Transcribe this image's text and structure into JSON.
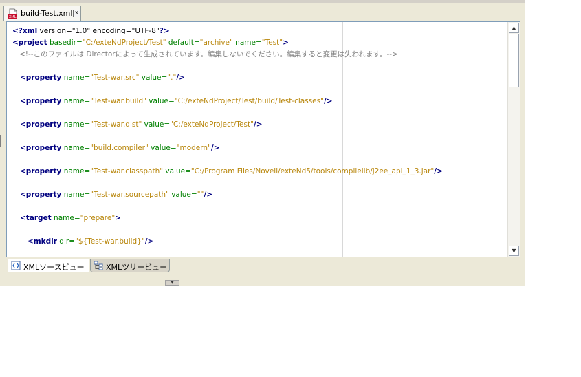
{
  "file_tab": {
    "label": "build-Test.xml",
    "icon": "xml-file-icon",
    "close_symbol": "x"
  },
  "code_lines": [
    [
      {
        "c": "tag",
        "t": "<?xml"
      },
      {
        "c": "txt",
        "t": " version=\"1.0\" encoding=\"UTF-8\""
      },
      {
        "c": "tag",
        "t": "?>"
      }
    ],
    [
      {
        "c": "tag",
        "t": "<project"
      },
      {
        "c": "attr",
        "t": " basedir="
      },
      {
        "c": "val",
        "t": "\"C:/exteNdProject/Test\""
      },
      {
        "c": "attr",
        "t": " default="
      },
      {
        "c": "val",
        "t": "\"archive\""
      },
      {
        "c": "attr",
        "t": " name="
      },
      {
        "c": "val",
        "t": "\"Test\""
      },
      {
        "c": "tag",
        "t": ">"
      }
    ],
    [
      {
        "c": "cmt",
        "t": "   <!--このファイルは Directorによって生成されています。編集しないでください。編集すると変更は失われます。-->"
      }
    ],
    [],
    [
      {
        "c": "tag",
        "t": "   <property"
      },
      {
        "c": "attr",
        "t": " name="
      },
      {
        "c": "val",
        "t": "\"Test-war.src\""
      },
      {
        "c": "attr",
        "t": " value="
      },
      {
        "c": "val",
        "t": "\".\""
      },
      {
        "c": "tag",
        "t": "/>"
      }
    ],
    [],
    [
      {
        "c": "tag",
        "t": "   <property"
      },
      {
        "c": "attr",
        "t": " name="
      },
      {
        "c": "val",
        "t": "\"Test-war.build\""
      },
      {
        "c": "attr",
        "t": " value="
      },
      {
        "c": "val",
        "t": "\"C:/exteNdProject/Test/build/Test-classes\""
      },
      {
        "c": "tag",
        "t": "/>"
      }
    ],
    [],
    [
      {
        "c": "tag",
        "t": "   <property"
      },
      {
        "c": "attr",
        "t": " name="
      },
      {
        "c": "val",
        "t": "\"Test-war.dist\""
      },
      {
        "c": "attr",
        "t": " value="
      },
      {
        "c": "val",
        "t": "\"C:/exteNdProject/Test\""
      },
      {
        "c": "tag",
        "t": "/>"
      }
    ],
    [],
    [
      {
        "c": "tag",
        "t": "   <property"
      },
      {
        "c": "attr",
        "t": " name="
      },
      {
        "c": "val",
        "t": "\"build.compiler\""
      },
      {
        "c": "attr",
        "t": " value="
      },
      {
        "c": "val",
        "t": "\"modern\""
      },
      {
        "c": "tag",
        "t": "/>"
      }
    ],
    [],
    [
      {
        "c": "tag",
        "t": "   <property"
      },
      {
        "c": "attr",
        "t": " name="
      },
      {
        "c": "val",
        "t": "\"Test-war.classpath\""
      },
      {
        "c": "attr",
        "t": " value="
      },
      {
        "c": "val",
        "t": "\"C:/Program Files/Novell/exteNd5/tools/compilelib/j2ee_api_1_3.jar\""
      },
      {
        "c": "tag",
        "t": "/>"
      }
    ],
    [],
    [
      {
        "c": "tag",
        "t": "   <property"
      },
      {
        "c": "attr",
        "t": " name="
      },
      {
        "c": "val",
        "t": "\"Test-war.sourcepath\""
      },
      {
        "c": "attr",
        "t": " value="
      },
      {
        "c": "val",
        "t": "\"\""
      },
      {
        "c": "tag",
        "t": "/>"
      }
    ],
    [],
    [
      {
        "c": "tag",
        "t": "   <target"
      },
      {
        "c": "attr",
        "t": " name="
      },
      {
        "c": "val",
        "t": "\"prepare\""
      },
      {
        "c": "tag",
        "t": ">"
      }
    ],
    [],
    [
      {
        "c": "tag",
        "t": "      <mkdir"
      },
      {
        "c": "attr",
        "t": " dir="
      },
      {
        "c": "val",
        "t": "\"${Test-war.build}\""
      },
      {
        "c": "tag",
        "t": "/>"
      }
    ]
  ],
  "bottom_tabs": [
    {
      "label": "XMLソースビュー",
      "icon": "xml-source-icon",
      "active": true
    },
    {
      "label": "XMLツリービュー",
      "icon": "xml-tree-icon",
      "active": false
    }
  ],
  "scrollbar": {
    "up_symbol": "▲",
    "down_symbol": "▼",
    "position_fraction": 0.0
  },
  "splitter": {
    "symbol": "▼"
  },
  "colors": {
    "tag": "#000080",
    "attribute": "#008000",
    "value": "#b8860b",
    "comment": "#808080"
  }
}
